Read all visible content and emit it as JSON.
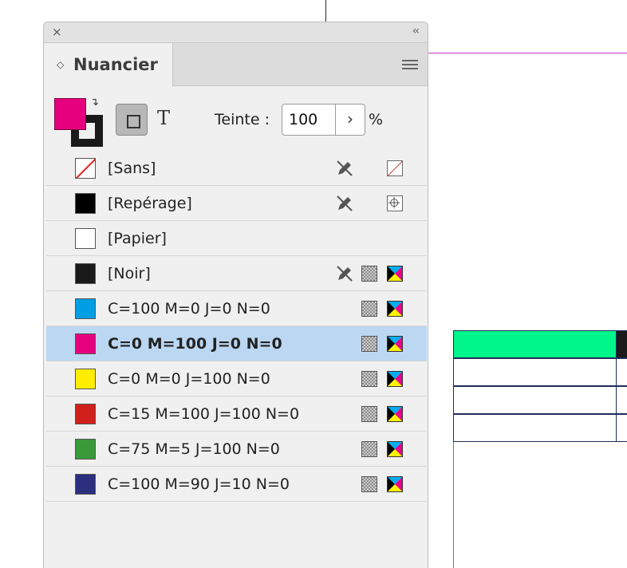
{
  "panel": {
    "title": "Nuancier",
    "close_glyph": "×",
    "collapse_glyph": "‹‹",
    "tab_chevron_glyph": "◇",
    "menu_icon": "hamburger-menu-icon",
    "text_button_glyph": "T",
    "swap_glyph": "↴"
  },
  "controls": {
    "fill_color": "#e6007e",
    "stroke_color": "#1a1a1a",
    "tint_label": "Teinte :",
    "tint_value": "100",
    "tint_stepper_glyph": "›",
    "tint_unit": "%"
  },
  "swatches": [
    {
      "name": "[Sans]",
      "color": "none",
      "edit_locked": true,
      "mode_icon": "none-swatch-icon"
    },
    {
      "name": "[Repérage]",
      "color": "#000000",
      "edit_locked": true,
      "mode_icon": "registration-icon"
    },
    {
      "name": "[Papier]",
      "color": "#ffffff",
      "edit_locked": false,
      "mode_icon": ""
    },
    {
      "name": "[Noir]",
      "color": "#1a1a1a",
      "edit_locked": true,
      "mode_icon": "cmyk-icon",
      "process": true
    },
    {
      "name": "C=100 M=0 J=0 N=0",
      "color": "#009fe3",
      "mode_icon": "cmyk-icon",
      "process": true
    },
    {
      "name": "C=0 M=100 J=0 N=0",
      "color": "#e6007e",
      "mode_icon": "cmyk-icon",
      "process": true,
      "selected": true
    },
    {
      "name": "C=0 M=0 J=100 N=0",
      "color": "#ffed00",
      "mode_icon": "cmyk-icon",
      "process": true
    },
    {
      "name": "C=15 M=100 J=100 N=0",
      "color": "#d0201c",
      "mode_icon": "cmyk-icon",
      "process": true
    },
    {
      "name": "C=75 M=5 J=100 N=0",
      "color": "#3a9a3a",
      "mode_icon": "cmyk-icon",
      "process": true
    },
    {
      "name": "C=100 M=90 J=10 N=0",
      "color": "#2b2f7e",
      "mode_icon": "cmyk-icon",
      "process": true
    }
  ],
  "document": {
    "table_header_color": "#00f58a"
  }
}
